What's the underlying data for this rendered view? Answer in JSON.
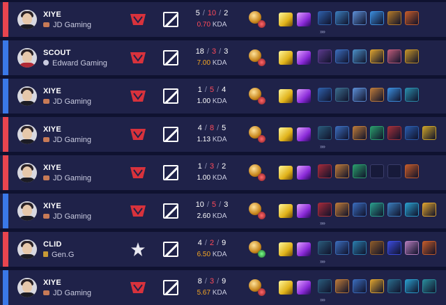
{
  "matches": [
    {
      "side_color": "#e8454f",
      "player": "XIYE",
      "team": "JD Gaming",
      "team_icon": "jdg",
      "kills": "5",
      "deaths": "10",
      "assists": "2",
      "kda": "0.70",
      "kda_color": "red",
      "rune_secondary": "red",
      "items": [
        "#2e5fa8",
        "#3a7ab8",
        "#5a8ad0",
        "#3a8ad8",
        "#b0782a",
        "#c05a2a"
      ],
      "more": "»»"
    },
    {
      "side_color": "#3a78e8",
      "player": "SCOUT",
      "team": "Edward Gaming",
      "team_icon": "edg",
      "kills": "18",
      "deaths": "3",
      "assists": "3",
      "kda": "7.00",
      "kda_color": "gold",
      "rune_secondary": "red",
      "items": [
        "#5a3a8a",
        "#3a6ab8",
        "#4a8ac0",
        "#d8a030",
        "#b85a78",
        "#c0902a"
      ],
      "more": ""
    },
    {
      "side_color": "#3a78e8",
      "player": "XIYE",
      "team": "JD Gaming",
      "team_icon": "jdg",
      "kills": "1",
      "deaths": "5",
      "assists": "4",
      "kda": "1.00",
      "kda_color": "white",
      "rune_secondary": "red",
      "items": [
        "#2e5fa8",
        "#3a6a8a",
        "#5a8ad0",
        "#b8783a",
        "#3a8ad8",
        "#2a8aa8"
      ],
      "more": ""
    },
    {
      "side_color": "#e8454f",
      "player": "XIYE",
      "team": "JD Gaming",
      "team_icon": "jdg",
      "kills": "4",
      "deaths": "8",
      "assists": "5",
      "kda": "1.13",
      "kda_color": "white",
      "rune_secondary": "red",
      "items": [
        "#2a5a7a",
        "#3a6ab8",
        "#b8783a",
        "#2a9a6a",
        "#a0303a",
        "#2a5aa8",
        "#c8a02a"
      ],
      "more": "»»"
    },
    {
      "side_color": "#e8454f",
      "player": "XIYE",
      "team": "JD Gaming",
      "team_icon": "jdg",
      "kills": "1",
      "deaths": "3",
      "assists": "2",
      "kda": "1.00",
      "kda_color": "white",
      "rune_secondary": "red",
      "items": [
        "#a02a3a",
        "#b8783a",
        "#2a9a6a",
        "",
        "",
        "#c05a2a"
      ],
      "more": ""
    },
    {
      "side_color": "#3a78e8",
      "player": "XIYE",
      "team": "JD Gaming",
      "team_icon": "jdg",
      "kills": "10",
      "deaths": "5",
      "assists": "3",
      "kda": "2.60",
      "kda_color": "white",
      "rune_secondary": "red",
      "items": [
        "#a02a3a",
        "#b8783a",
        "#3a6ab8",
        "#2a9a8a",
        "#3a7ab8",
        "#2a9ac8",
        "#d8a030"
      ],
      "more": "»»"
    },
    {
      "side_color": "#e8454f",
      "player": "CLID",
      "team": "Gen.G",
      "team_icon": "geng",
      "kills": "4",
      "deaths": "2",
      "assists": "9",
      "kda": "6.50",
      "kda_color": "gold",
      "rune_secondary": "green",
      "items": [
        "#2a5a7a",
        "#3a6ab8",
        "#2a7aa8",
        "#8a5a2a",
        "#3a4ad8",
        "#b07ab8",
        "#c05a2a"
      ],
      "more": "»»"
    },
    {
      "side_color": "#3a78e8",
      "player": "XIYE",
      "team": "JD Gaming",
      "team_icon": "jdg",
      "kills": "8",
      "deaths": "3",
      "assists": "9",
      "kda": "5.67",
      "kda_color": "gold",
      "rune_secondary": "red",
      "items": [
        "#2a5a7a",
        "#b8783a",
        "#3a6ab8",
        "#d8a030",
        "#2a6a8a",
        "#2a9ac8",
        "#2a8a9a"
      ],
      "more": "»»"
    }
  ],
  "kda_suffix": "KDA",
  "slash": "/"
}
